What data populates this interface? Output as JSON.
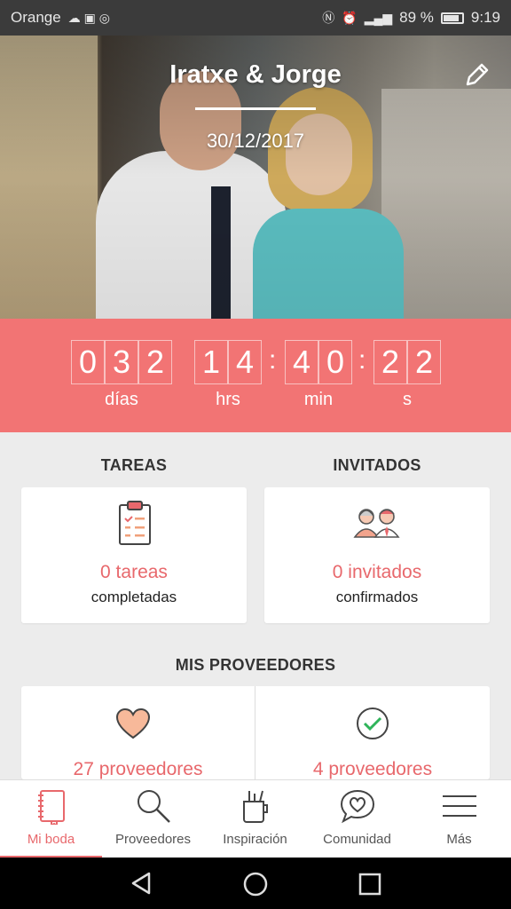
{
  "status_bar": {
    "carrier": "Orange",
    "battery": "89 %",
    "time": "9:19"
  },
  "hero": {
    "couple": "Iratxe & Jorge",
    "date": "30/12/2017"
  },
  "countdown": {
    "days": [
      "0",
      "3",
      "2"
    ],
    "hours": [
      "1",
      "4"
    ],
    "minutes": [
      "4",
      "0"
    ],
    "seconds": [
      "2",
      "2"
    ],
    "labels": {
      "days": "días",
      "hours": "hrs",
      "minutes": "min",
      "seconds": "s"
    }
  },
  "tasks": {
    "title": "TAREAS",
    "count": "0 tareas",
    "sub": "completadas"
  },
  "guests": {
    "title": "INVITADOS",
    "count": "0 invitados",
    "sub": "confirmados"
  },
  "vendors": {
    "title": "MIS PROVEEDORES",
    "favorites": "27 proveedores",
    "hired": "4 proveedores"
  },
  "nav": {
    "items": [
      {
        "label": "Mi boda",
        "icon": "notebook-icon",
        "active": true
      },
      {
        "label": "Proveedores",
        "icon": "search-icon"
      },
      {
        "label": "Inspiración",
        "icon": "cup-icon"
      },
      {
        "label": "Comunidad",
        "icon": "chat-heart-icon"
      },
      {
        "label": "Más",
        "icon": "menu-icon"
      }
    ]
  },
  "colors": {
    "accent": "#f27474",
    "accent_text": "#e8686c",
    "background": "#ececec"
  }
}
